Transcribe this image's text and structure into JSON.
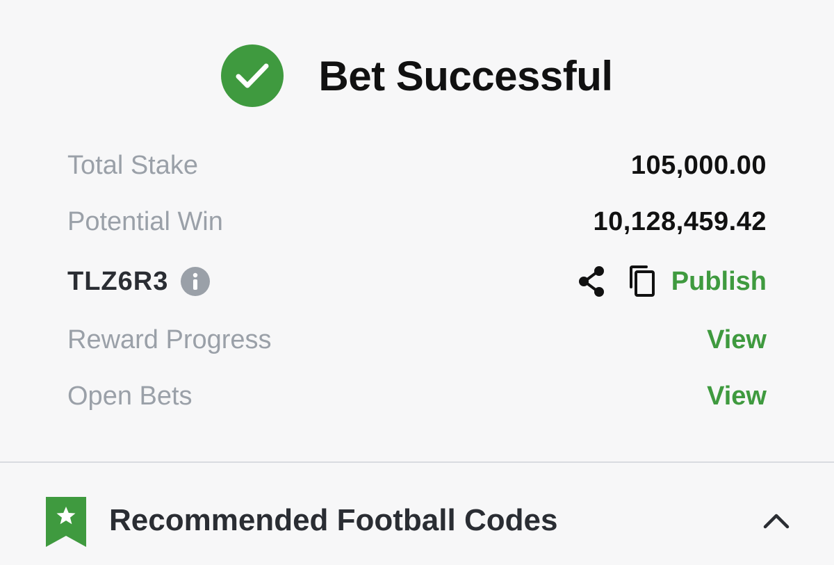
{
  "header": {
    "title": "Bet Successful",
    "icon": "check-circle-icon",
    "accent": "#3f9a3f"
  },
  "summary": {
    "total_stake_label": "Total Stake",
    "total_stake_value": "105,000.00",
    "potential_win_label": "Potential Win",
    "potential_win_value": "10,128,459.42",
    "booking_code": "TLZ6R3",
    "publish_label": "Publish",
    "reward_progress_label": "Reward Progress",
    "reward_progress_link": "View",
    "open_bets_label": "Open Bets",
    "open_bets_link": "View"
  },
  "recommended": {
    "title": "Recommended Football Codes",
    "icon": "bookmark-star-icon",
    "toggle_icon": "chevron-up-icon"
  }
}
